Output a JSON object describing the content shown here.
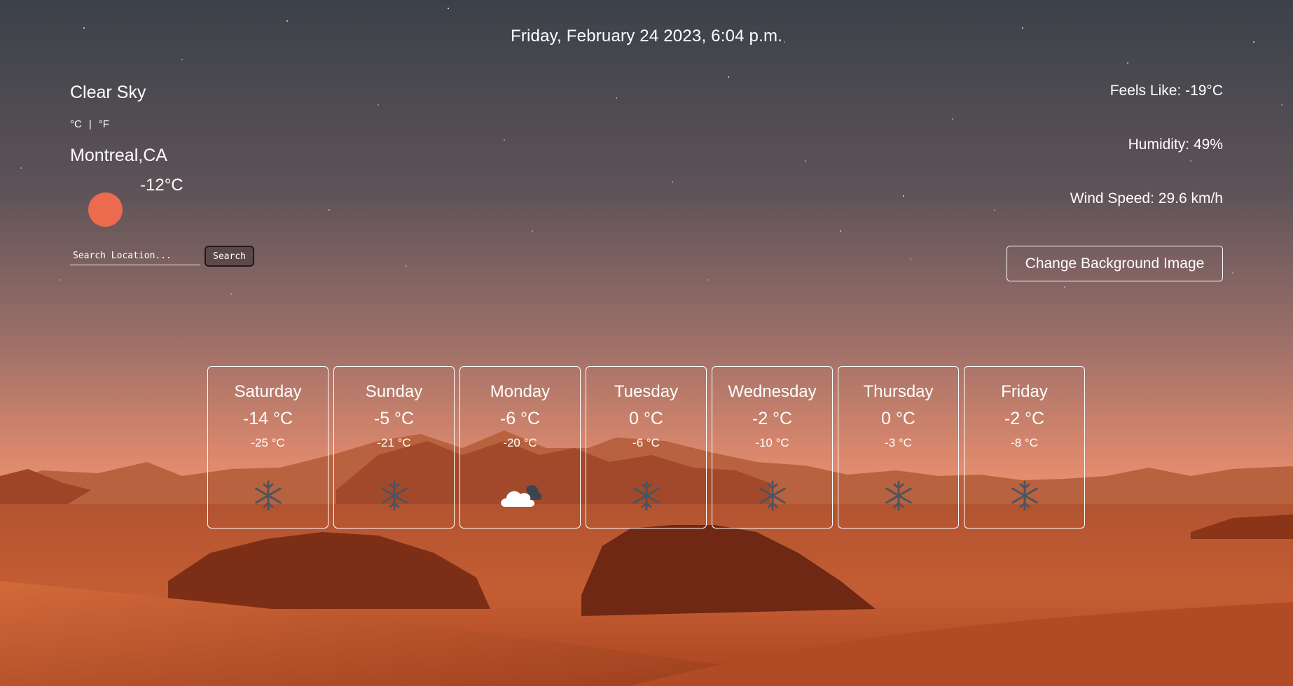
{
  "header": {
    "datetime": "Friday, February 24 2023, 6:04 p.m."
  },
  "current": {
    "condition": "Clear Sky",
    "unit_celsius": "°C",
    "unit_separator": "|",
    "unit_fahrenheit": "°F",
    "city": "Montreal,CA",
    "temperature": "-12°C",
    "icon": "sun-icon"
  },
  "search": {
    "placeholder": "Search Location...",
    "button_label": "Search"
  },
  "stats": {
    "feels_like": "Feels Like: -19°C",
    "humidity": "Humidity: 49%",
    "wind_speed": "Wind Speed: 29.6 km/h"
  },
  "background": {
    "button_label": "Change Background Image"
  },
  "forecast": [
    {
      "day": "Saturday",
      "high": "-14 °C",
      "low": "-25 °C",
      "icon": "snowflake-icon"
    },
    {
      "day": "Sunday",
      "high": "-5 °C",
      "low": "-21 °C",
      "icon": "snowflake-icon"
    },
    {
      "day": "Monday",
      "high": "-6 °C",
      "low": "-20 °C",
      "icon": "cloud-icon"
    },
    {
      "day": "Tuesday",
      "high": "0 °C",
      "low": "-6 °C",
      "icon": "snowflake-icon"
    },
    {
      "day": "Wednesday",
      "high": "-2 °C",
      "low": "-10 °C",
      "icon": "snowflake-icon"
    },
    {
      "day": "Thursday",
      "high": "0 °C",
      "low": "-3 °C",
      "icon": "snowflake-icon"
    },
    {
      "day": "Friday",
      "high": "-2 °C",
      "low": "-8 °C",
      "icon": "snowflake-icon"
    }
  ],
  "colors": {
    "sun": "#ec6a4e",
    "sky_top": "#3c4149",
    "horizon": "#ea8f6e",
    "sand": "#c2562c",
    "snowflake": "#4a5560"
  }
}
